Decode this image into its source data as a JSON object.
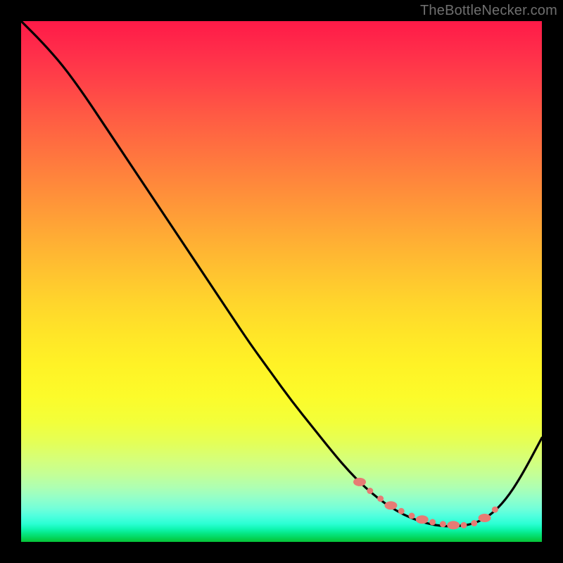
{
  "watermark": "TheBottleNecker.com",
  "chart_data": {
    "type": "line",
    "title": "",
    "xlabel": "",
    "ylabel": "",
    "xlim": [
      0,
      100
    ],
    "ylim": [
      0,
      100
    ],
    "background": "red-yellow-green vertical gradient",
    "annotations": "salmon dotted segment near trough",
    "series": [
      {
        "name": "bottleneck-curve",
        "x": [
          0,
          4,
          8,
          12,
          16,
          20,
          24,
          28,
          32,
          36,
          40,
          44,
          48,
          52,
          56,
          60,
          63,
          66,
          69,
          72,
          75,
          78,
          81,
          84,
          87,
          90,
          93,
          96,
          100
        ],
        "y": [
          100,
          96,
          91.5,
          86,
          80,
          74,
          68,
          62,
          56,
          50,
          44,
          38,
          32.5,
          27,
          22,
          17,
          13.5,
          10.5,
          8,
          6,
          4.5,
          3.5,
          3,
          3,
          3.5,
          5,
          8,
          12.5,
          20
        ]
      }
    ],
    "dotted_segment": {
      "name": "highlight-dots",
      "x": [
        65,
        67,
        69,
        71,
        73,
        75,
        77,
        79,
        81,
        83,
        85,
        87,
        89,
        91
      ],
      "y": [
        11.5,
        9.8,
        8.3,
        7,
        5.9,
        5,
        4.3,
        3.8,
        3.4,
        3.2,
        3.2,
        3.6,
        4.6,
        6.2
      ]
    },
    "colors": {
      "curve": "#000000",
      "dots": "#e77b74",
      "frame": "#000000"
    }
  }
}
